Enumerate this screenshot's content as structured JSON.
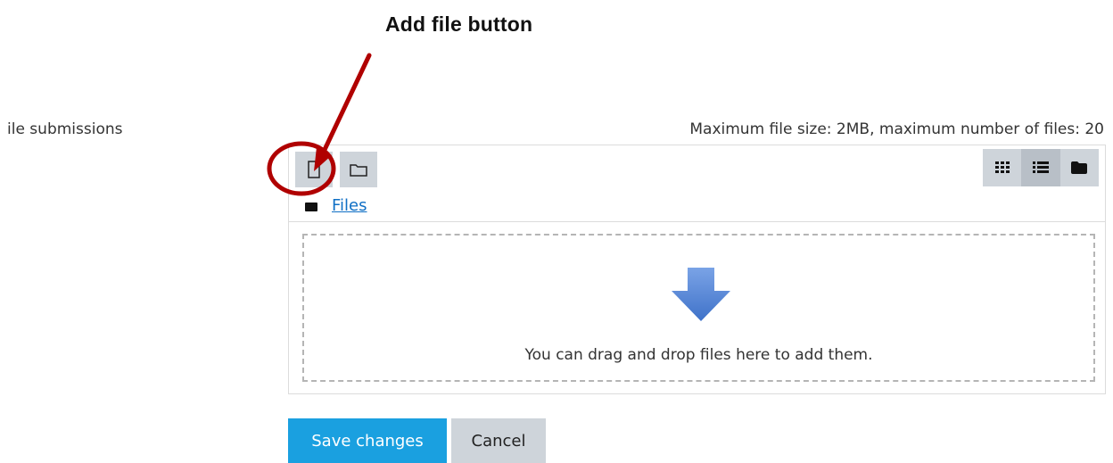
{
  "annotation": {
    "title": "Add file button"
  },
  "form": {
    "field_label": "ile submissions",
    "limits_text": "Maximum file size: 2MB, maximum number of files: 20"
  },
  "filepicker": {
    "toolbar": {
      "add_file_icon": "file-icon",
      "create_folder_icon": "folder-outline-icon",
      "views": [
        {
          "name": "icons-view",
          "icon": "grid-icon",
          "active": false
        },
        {
          "name": "list-view",
          "icon": "list-icon",
          "active": true
        },
        {
          "name": "tree-view",
          "icon": "folder-solid-icon",
          "active": false
        }
      ]
    },
    "path_label": "Files",
    "drop_text": "You can drag and drop files here to add them."
  },
  "buttons": {
    "save_label": "Save changes",
    "cancel_label": "Cancel"
  },
  "colors": {
    "primary": "#1aa0e0",
    "secondary": "#ced4da",
    "link": "#0f6fc5",
    "annotation_red": "#b00000",
    "drop_arrow": "#5b8bd6"
  }
}
